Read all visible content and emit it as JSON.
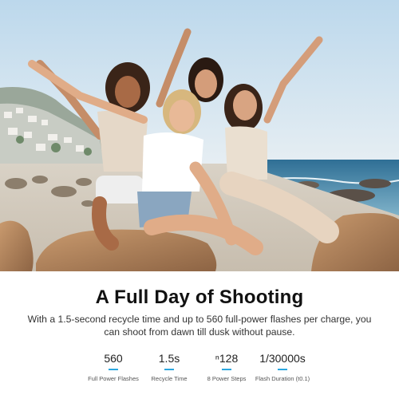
{
  "headline": "A Full Day of Shooting",
  "description": "With a 1.5-second recycle time and up to 560 full-power flashes per charge, you can shoot from dawn till dusk without pause.",
  "stats": [
    {
      "value": "560",
      "label": "Full Power Flashes"
    },
    {
      "value": "1.5s",
      "label": "Recycle Time"
    },
    {
      "value": "ⁿ128",
      "label": "8 Power Steps"
    },
    {
      "value": "1/30000s",
      "label": "Flash Duration (t0.1)"
    }
  ],
  "colors": {
    "accent": "#2aa7e0",
    "text": "#111111",
    "sky": "#cfe3f0",
    "sea": "#3d7fa3",
    "rock": "#b8875f"
  }
}
